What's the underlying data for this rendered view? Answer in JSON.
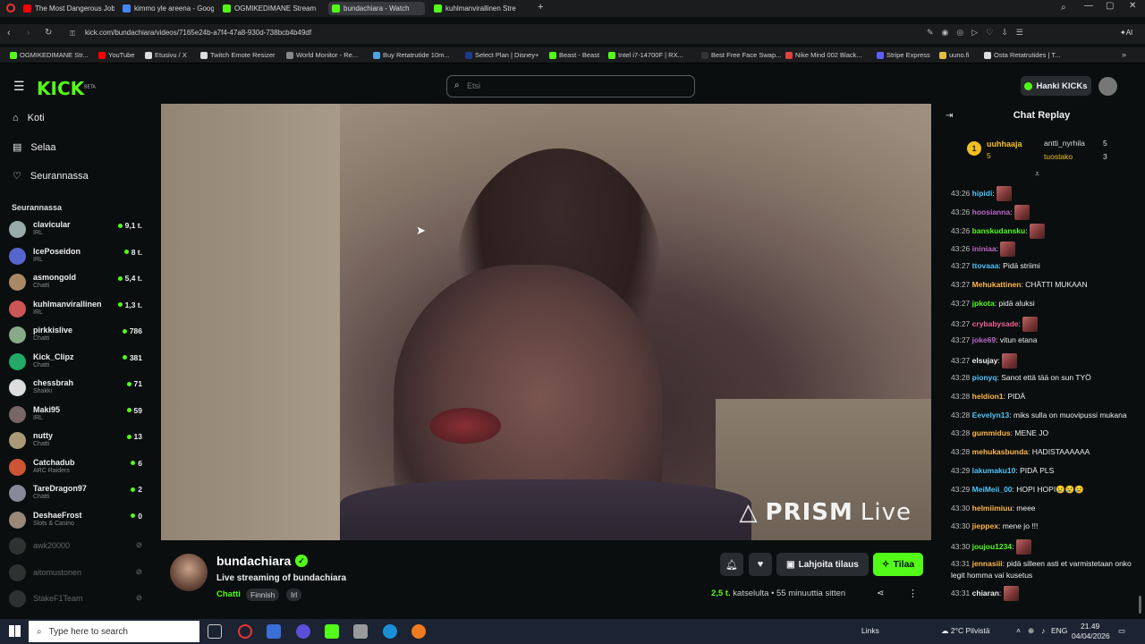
{
  "browser": {
    "tabs": [
      {
        "label": "The Most Dangerous Job i",
        "color": "#ff0000",
        "active": false
      },
      {
        "label": "kimmo yle areena - Googl",
        "color": "#4285f4",
        "active": false
      },
      {
        "label": "OGMIKEDIMANE Stream",
        "color": "#53fc18",
        "active": false
      },
      {
        "label": "bundachiara - Watch",
        "color": "#53fc18",
        "active": true
      },
      {
        "label": "kuhlmanvirallinen Stre",
        "color": "#53fc18",
        "active": false
      }
    ],
    "url": "kick.com/bundachiara/videos/7165e24b-a7f4-47a8-930d-738bcb4b49df",
    "bookmarks": [
      {
        "label": "OGMIKEDIMANE Str...",
        "color": "#53fc18"
      },
      {
        "label": "YouTube",
        "color": "#ff0000"
      },
      {
        "label": "Etusivu / X",
        "color": "#dddddd"
      },
      {
        "label": "Twitch Emote Resizer",
        "color": "#dddddd"
      },
      {
        "label": "World Monitor - Re...",
        "color": "#888888"
      },
      {
        "label": "Buy Retatrutide 10m...",
        "color": "#4fa3e0"
      },
      {
        "label": "Select Plan | Disney+",
        "color": "#1f3a8a"
      },
      {
        "label": "Beast - Beast",
        "color": "#53fc18"
      },
      {
        "label": "Intel i7-14700F | RX...",
        "color": "#53fc18"
      },
      {
        "label": "Best Free Face Swap...",
        "color": "#333333"
      },
      {
        "label": "Nike Mind 002 Black...",
        "color": "#e04040"
      },
      {
        "label": "Stripe Express",
        "color": "#635bff"
      },
      {
        "label": "uuno.fi",
        "color": "#e0c040"
      },
      {
        "label": "Osta Retatrutides | T...",
        "color": "#dddddd"
      }
    ]
  },
  "header": {
    "logo": "KICK",
    "logo_badge": "BETA",
    "search_placeholder": "Etsi",
    "hanki_label": "Hanki KICKs"
  },
  "sidebar": {
    "nav": [
      {
        "label": "Koti",
        "icon": "home-icon"
      },
      {
        "label": "Selaa",
        "icon": "browse-icon"
      },
      {
        "label": "Seurannassa",
        "icon": "heart-icon"
      }
    ],
    "following_title": "Seurannassa",
    "following": [
      {
        "name": "clavicular",
        "category": "IRL",
        "viewers": "9,1 t.",
        "live": true,
        "color": "#9aa"
      },
      {
        "name": "IcePoseidon",
        "category": "IRL",
        "viewers": "8 t.",
        "live": true,
        "color": "#56c"
      },
      {
        "name": "asmongold",
        "category": "Chatti",
        "viewers": "5,4 t.",
        "live": true,
        "color": "#a86"
      },
      {
        "name": "kuhlmanvirallinen",
        "category": "IRL",
        "viewers": "1,3 t.",
        "live": true,
        "color": "#c55"
      },
      {
        "name": "pirkkislive",
        "category": "Chatti",
        "viewers": "786",
        "live": true,
        "color": "#8a8"
      },
      {
        "name": "Kick_Clipz",
        "category": "Chatti",
        "viewers": "381",
        "live": true,
        "color": "#2a6"
      },
      {
        "name": "chessbrah",
        "category": "Shakki",
        "viewers": "71",
        "live": true,
        "color": "#ddd"
      },
      {
        "name": "Maki95",
        "category": "IRL",
        "viewers": "59",
        "live": true,
        "color": "#766"
      },
      {
        "name": "nutty",
        "category": "Chatti",
        "viewers": "13",
        "live": true,
        "color": "#a97"
      },
      {
        "name": "Catchadub",
        "category": "ARC Raiders",
        "viewers": "6",
        "live": true,
        "color": "#c53"
      },
      {
        "name": "TareDragon97",
        "category": "Chatti",
        "viewers": "2",
        "live": true,
        "color": "#889"
      },
      {
        "name": "DeshaeFrost",
        "category": "Slots & Casino",
        "viewers": "0",
        "live": true,
        "color": "#987"
      },
      {
        "name": "awk20000",
        "category": "",
        "viewers": "",
        "live": false,
        "color": "#555"
      },
      {
        "name": "aitomustonen",
        "category": "",
        "viewers": "",
        "live": false,
        "color": "#555"
      },
      {
        "name": "StakeF1Team",
        "category": "",
        "viewers": "",
        "live": false,
        "color": "#555"
      }
    ]
  },
  "video": {
    "watermark": "PRISM",
    "watermark_live": "Live"
  },
  "channel": {
    "name": "bundachiara",
    "title": "Live streaming of bundachiara",
    "category": "Chatti",
    "tags": [
      "Finnish",
      "Irl"
    ],
    "gift_label": "Lahjoita tilaus",
    "subscribe_label": "Tilaa",
    "viewers_count": "2,5 t.",
    "viewers_label": "katselulta",
    "age": "55 minuuttia sitten"
  },
  "chat": {
    "title": "Chat Replay",
    "leaderboard": [
      {
        "rank": "1",
        "name": "uuhhaaja",
        "count": "5"
      },
      {
        "rank": "",
        "name": "antti_nyrhila",
        "count": "5"
      },
      {
        "rank": "",
        "name": "tuostako",
        "count": "3"
      }
    ],
    "messages": [
      {
        "time": "43:26",
        "user": "hipidi",
        "color": "#4fc3f7",
        "text": "",
        "emote": true
      },
      {
        "time": "43:26",
        "user": "hoosianna",
        "color": "#ba68c8",
        "text": "",
        "emote": true
      },
      {
        "time": "43:26",
        "user": "banskudansku",
        "color": "#53fc18",
        "text": "",
        "emote": true
      },
      {
        "time": "43:26",
        "user": "ininiaa",
        "color": "#ba68c8",
        "text": "",
        "emote": true
      },
      {
        "time": "43:27",
        "user": "ttovaaa",
        "color": "#4fc3f7",
        "text": "Pidä striimi",
        "emote": false
      },
      {
        "time": "43:27",
        "user": "Mehukattinen",
        "color": "#ffb74d",
        "text": "CHÄTTI MUKAAN",
        "emote": false
      },
      {
        "time": "43:27",
        "user": "jpkota",
        "color": "#53fc18",
        "text": "pidä aluksi",
        "emote": false
      },
      {
        "time": "43:27",
        "user": "crybabysade",
        "color": "#f06292",
        "text": "",
        "emote": true
      },
      {
        "time": "43:27",
        "user": "joke69",
        "color": "#ba68c8",
        "text": "vitun etana",
        "emote": false
      },
      {
        "time": "43:27",
        "user": "elsujay",
        "color": "#eeeeee",
        "text": "",
        "emote": true
      },
      {
        "time": "43:28",
        "user": "pionyq",
        "color": "#4fc3f7",
        "text": "Sanot että tää on sun TYÖ",
        "emote": false
      },
      {
        "time": "43:28",
        "user": "heldion1",
        "color": "#ffb74d",
        "text": "PIDÄ",
        "emote": false
      },
      {
        "time": "43:28",
        "user": "Eevelyn13",
        "color": "#4fc3f7",
        "text": "miks sulla on muovipussi mukana",
        "emote": false
      },
      {
        "time": "43:28",
        "user": "gummidus",
        "color": "#ffb74d",
        "text": "MENE JO",
        "emote": false
      },
      {
        "time": "43:28",
        "user": "mehukasbunda",
        "color": "#ffb74d",
        "text": "HADISTAAAAAA",
        "emote": false
      },
      {
        "time": "43:29",
        "user": "lakumaku10",
        "color": "#4fc3f7",
        "text": "PIDÄ PLS",
        "emote": false
      },
      {
        "time": "43:29",
        "user": "MeiMeii_00",
        "color": "#4fc3f7",
        "text": "HOPI HOPI😢😢😢",
        "emote": false
      },
      {
        "time": "43:30",
        "user": "helmiimiuu",
        "color": "#ffb74d",
        "text": "meee",
        "emote": false
      },
      {
        "time": "43:30",
        "user": "jieppex",
        "color": "#ffb74d",
        "text": "mene jo !!!",
        "emote": false
      },
      {
        "time": "43:30",
        "user": "joujou1234",
        "color": "#53fc18",
        "text": "",
        "emote": true
      },
      {
        "time": "43:31",
        "user": "jennasiii",
        "color": "#ffb74d",
        "text": "pidä silleen asti et varmistetaan onko legit homma vai kusetus",
        "emote": false
      },
      {
        "time": "43:31",
        "user": "chiaran",
        "color": "#eeeeee",
        "text": "",
        "emote": true
      }
    ]
  },
  "taskbar": {
    "search_placeholder": "Type here to search",
    "links": "Links",
    "weather": "2°C Pilvistä",
    "lang": "ENG",
    "time": "21.49",
    "date": "04/04/2026"
  }
}
